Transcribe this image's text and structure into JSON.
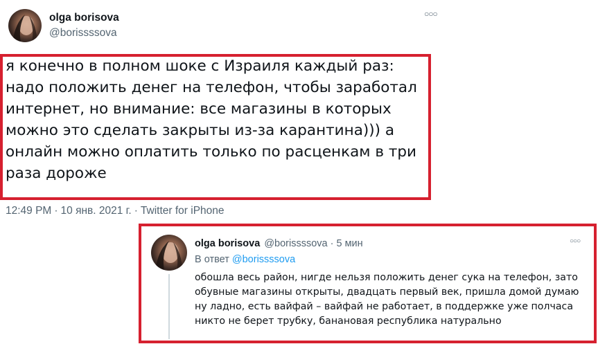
{
  "tweet": {
    "author_name": "olga borisova",
    "author_handle": "@borissssova",
    "more_icon": "more-horizontal-icon",
    "text": "я конечно в полном шоке с Израиля каждый раз:\nнадо положить денег на телефон, чтобы заработал\nинтернет, но внимание: все магазины в которых\nможно это сделать закрыты из-за карантина))) а\nонлайн можно оплатить только по расценкам в три\nраза дороже",
    "time": "12:49 PM",
    "date": "10 янв. 2021 г.",
    "separator": "·",
    "source": "Twitter for iPhone"
  },
  "reply": {
    "author_name": "olga borisova",
    "author_handle": "@borissssova",
    "separator": "·",
    "time_ago": "5 мин",
    "more_icon": "more-horizontal-icon",
    "reply_to_label": "В ответ",
    "reply_to_handle": "@borissssova",
    "text": "обошла весь район, нигде нельзя положить денег сука на телефон, зато\nобувные магазины открыты, двадцать первый век, пришла домой думаю\nну ладно, есть вайфай – вайфай не работает, в поддержке уже полчаса\nникто не берет трубку, банановая республика натурально"
  },
  "colors": {
    "highlight_border": "#d6202f",
    "link": "#1d9bf0",
    "secondary_text": "#536471"
  }
}
